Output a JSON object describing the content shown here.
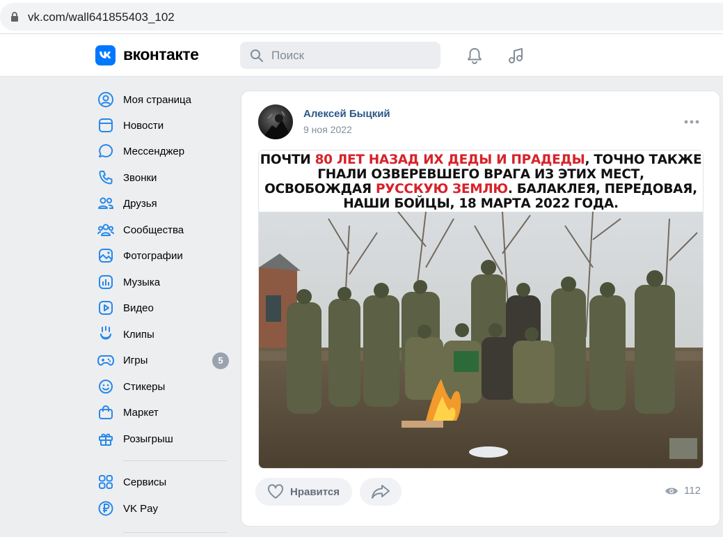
{
  "browser": {
    "url": "vk.com/wall641855403_102"
  },
  "header": {
    "logo_text": "вконтакте",
    "search_placeholder": "Поиск"
  },
  "nav": {
    "items": [
      {
        "label": "Моя страница",
        "icon": "profile-icon"
      },
      {
        "label": "Новости",
        "icon": "news-icon"
      },
      {
        "label": "Мессенджер",
        "icon": "messenger-icon"
      },
      {
        "label": "Звонки",
        "icon": "phone-icon"
      },
      {
        "label": "Друзья",
        "icon": "friends-icon"
      },
      {
        "label": "Сообщества",
        "icon": "communities-icon"
      },
      {
        "label": "Фотографии",
        "icon": "photos-icon"
      },
      {
        "label": "Музыка",
        "icon": "music-icon"
      },
      {
        "label": "Видео",
        "icon": "video-icon"
      },
      {
        "label": "Клипы",
        "icon": "clips-icon"
      },
      {
        "label": "Игры",
        "icon": "games-icon",
        "badge": "5"
      },
      {
        "label": "Стикеры",
        "icon": "stickers-icon"
      },
      {
        "label": "Маркет",
        "icon": "market-icon"
      },
      {
        "label": "Розыгрыш",
        "icon": "giveaway-icon"
      },
      {
        "label": "Сервисы",
        "icon": "services-icon"
      },
      {
        "label": "VK Pay",
        "icon": "vkpay-icon"
      }
    ]
  },
  "post": {
    "author": "Алексей Быцкий",
    "date": "9 ноя 2022",
    "caption": {
      "l1a": "ПОЧТИ ",
      "l1b": "80 ЛЕТ НАЗАД ИХ ДЕДЫ И ПРАДЕДЫ",
      "l1c": ", ТОЧНО ТАКЖЕ",
      "l2": "ГНАЛИ ОЗВЕРЕВШЕГО ВРАГА ИЗ ЭТИХ МЕСТ,",
      "l3a": "ОСВОБОЖДАЯ ",
      "l3b": "РУССКУЮ ЗЕМЛЮ",
      "l3c": ". БАЛАКЛЕЯ, ПЕРЕДОВАЯ,",
      "l4": "НАШИ БОЙЦЫ, 18 МАРТА 2022 ГОДА."
    },
    "like_label": "Нравится",
    "views": "112"
  },
  "colors": {
    "vk_blue": "#0077ff",
    "link": "#2a5885",
    "accent_red": "#d8222a",
    "muted": "#818c99"
  }
}
